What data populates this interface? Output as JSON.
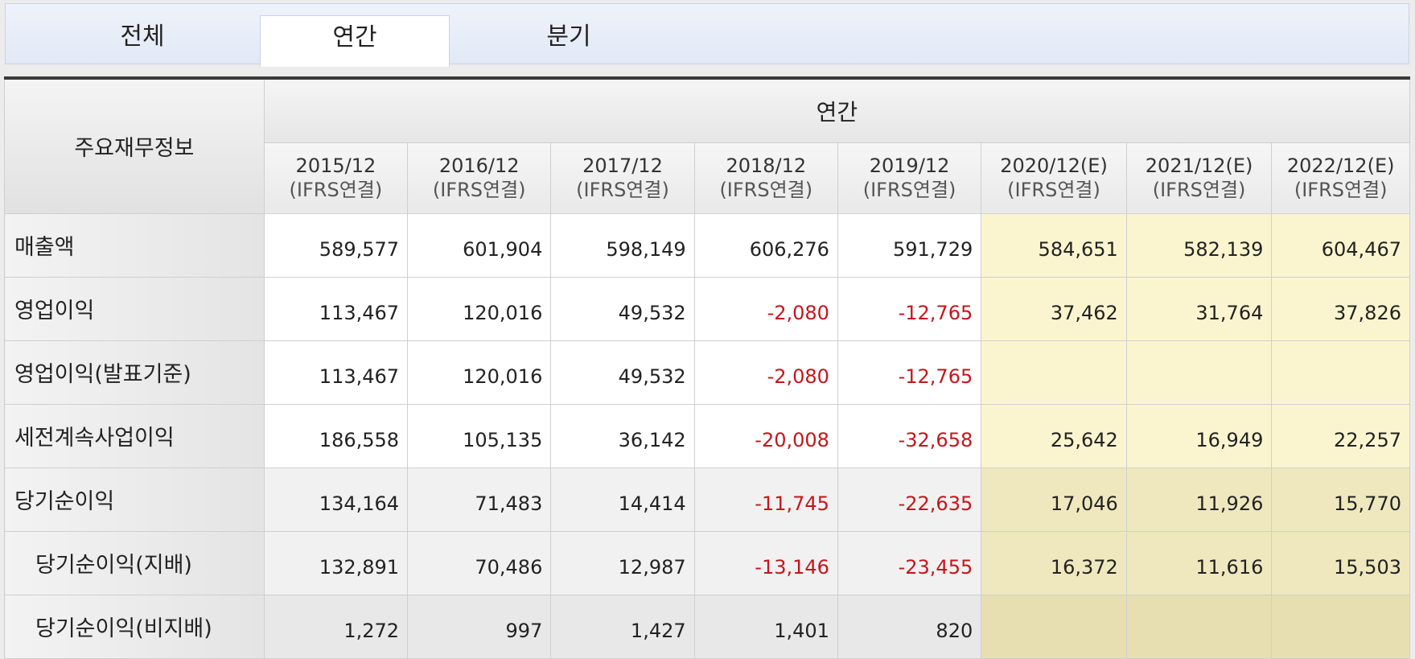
{
  "tabs": [
    {
      "label": "전체",
      "active": false
    },
    {
      "label": "연간",
      "active": true
    },
    {
      "label": "분기",
      "active": false
    }
  ],
  "table": {
    "row_header": "주요재무정보",
    "group_header": "연간",
    "columns": [
      {
        "period": "2015/12",
        "basis": "(IFRS연결)",
        "estimate": false
      },
      {
        "period": "2016/12",
        "basis": "(IFRS연결)",
        "estimate": false
      },
      {
        "period": "2017/12",
        "basis": "(IFRS연결)",
        "estimate": false
      },
      {
        "period": "2018/12",
        "basis": "(IFRS연결)",
        "estimate": false
      },
      {
        "period": "2019/12",
        "basis": "(IFRS연결)",
        "estimate": false
      },
      {
        "period": "2020/12(E)",
        "basis": "(IFRS연결)",
        "estimate": true
      },
      {
        "period": "2021/12(E)",
        "basis": "(IFRS연결)",
        "estimate": true
      },
      {
        "period": "2022/12(E)",
        "basis": "(IFRS연결)",
        "estimate": true
      }
    ],
    "rows": [
      {
        "label": "매출액",
        "indent": false,
        "values": [
          "589,577",
          "601,904",
          "598,149",
          "606,276",
          "591,729",
          "584,651",
          "582,139",
          "604,467"
        ]
      },
      {
        "label": "영업이익",
        "indent": false,
        "values": [
          "113,467",
          "120,016",
          "49,532",
          "-2,080",
          "-12,765",
          "37,462",
          "31,764",
          "37,826"
        ]
      },
      {
        "label": "영업이익(발표기준)",
        "indent": false,
        "values": [
          "113,467",
          "120,016",
          "49,532",
          "-2,080",
          "-12,765",
          "",
          "",
          ""
        ]
      },
      {
        "label": "세전계속사업이익",
        "indent": false,
        "values": [
          "186,558",
          "105,135",
          "36,142",
          "-20,008",
          "-32,658",
          "25,642",
          "16,949",
          "22,257"
        ]
      },
      {
        "label": "당기순이익",
        "indent": false,
        "values": [
          "134,164",
          "71,483",
          "14,414",
          "-11,745",
          "-22,635",
          "17,046",
          "11,926",
          "15,770"
        ]
      },
      {
        "label": "당기순이익(지배)",
        "indent": true,
        "values": [
          "132,891",
          "70,486",
          "12,987",
          "-13,146",
          "-23,455",
          "16,372",
          "11,616",
          "15,503"
        ]
      },
      {
        "label": "당기순이익(비지배)",
        "indent": true,
        "values": [
          "1,272",
          "997",
          "1,427",
          "1,401",
          "820",
          "",
          "",
          ""
        ]
      }
    ]
  },
  "colors": {
    "negative": "#c4161c",
    "estimate_bg": "#fbf5cf",
    "header_rule": "#3a3a3a"
  }
}
